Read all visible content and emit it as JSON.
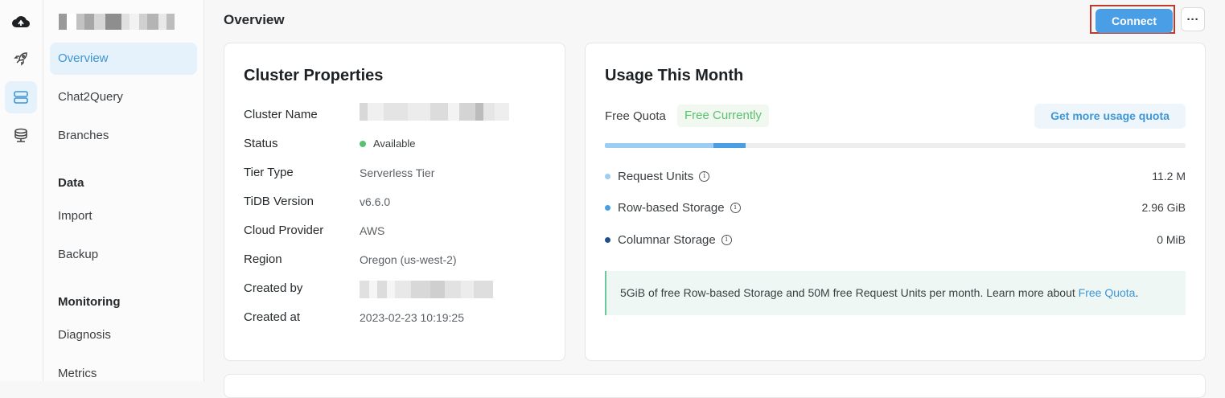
{
  "rail": {
    "icons": [
      "cloud-logo-icon",
      "rocket-icon",
      "cluster-icon",
      "database-icon"
    ]
  },
  "nav": {
    "items": {
      "overview": "Overview",
      "chat2query": "Chat2Query",
      "branches": "Branches",
      "import": "Import",
      "backup": "Backup",
      "diagnosis": "Diagnosis",
      "metrics": "Metrics"
    },
    "sections": {
      "data": "Data",
      "monitoring": "Monitoring"
    }
  },
  "header": {
    "title": "Overview",
    "connect_label": "Connect",
    "more_label": "···"
  },
  "cluster_properties": {
    "title": "Cluster Properties",
    "labels": {
      "name": "Cluster Name",
      "status": "Status",
      "tier": "Tier Type",
      "version": "TiDB Version",
      "provider": "Cloud Provider",
      "region": "Region",
      "created_by": "Created by",
      "created_at": "Created at"
    },
    "values": {
      "status": "Available",
      "tier": "Serverless Tier",
      "version": "v6.6.0",
      "provider": "AWS",
      "region": "Oregon (us-west-2)",
      "created_at": "2023-02-23 10:19:25"
    }
  },
  "usage": {
    "title": "Usage This Month",
    "free_quota_label": "Free Quota",
    "free_badge": "Free Currently",
    "more_quota_button": "Get more usage quota",
    "progress": {
      "request_units_fraction": 0.187,
      "row_storage_fraction": 0.055
    },
    "rows": {
      "request_units": {
        "label": "Request Units",
        "value": "11.2 M"
      },
      "row_storage": {
        "label": "Row-based Storage",
        "value": "2.96 GiB"
      },
      "columnar_storage": {
        "label": "Columnar Storage",
        "value": "0 MiB"
      }
    },
    "notice": {
      "text": "5GiB of free Row-based Storage and 50M free Request Units per month. Learn more about ",
      "link": "Free Quota",
      "end": "."
    }
  },
  "colors": {
    "accent": "#4a9ee5",
    "status_available": "#5cc070",
    "request_units_dot": "#9dcdf0",
    "row_storage_dot": "#4a9ee5",
    "columnar_dot": "#1f4f8a",
    "free_badge_text": "#5cc070"
  }
}
